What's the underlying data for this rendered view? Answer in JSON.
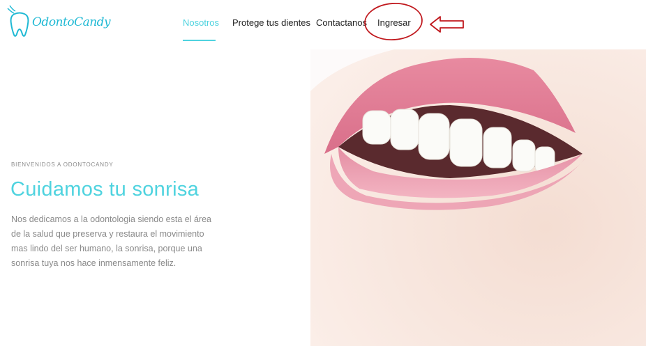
{
  "brand": {
    "name": "OdontoCandy",
    "logo_icon": "tooth-icon",
    "accent_color": "#4fd3df"
  },
  "nav": {
    "items": [
      {
        "label": "Nosotros",
        "active": true
      },
      {
        "label": "Protege tus dientes",
        "active": false
      },
      {
        "label": "Contactanos",
        "active": false
      },
      {
        "label": "Ingresar",
        "active": false
      }
    ]
  },
  "annotation": {
    "circle_color": "#c0181d",
    "arrow_icon": "left-arrow-icon"
  },
  "hero": {
    "eyebrow": "BIENVENIDOS A ODONTOCANDY",
    "title": "Cuidamos tu sonrisa",
    "body": "Nos dedicamos a la odontologia siendo esta el área de la salud que preserva y restaura el movimiento mas lindo del ser humano, la sonrisa, porque una sonrisa tuya nos hace inmensamente feliz.",
    "image": "smiling-lips-photo"
  }
}
